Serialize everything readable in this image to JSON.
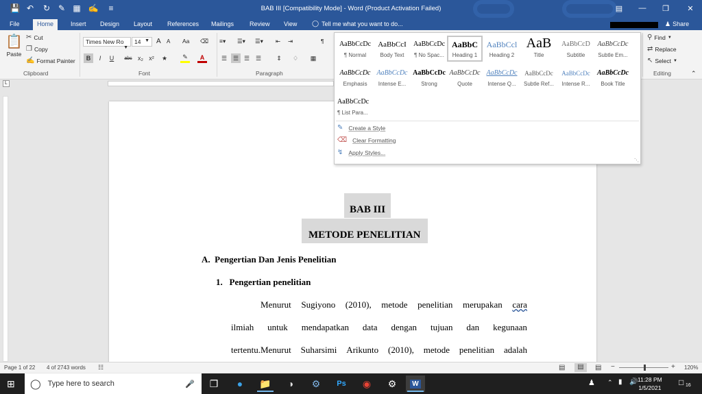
{
  "titlebar": {
    "title": "BAB III [Compatibility Mode] - Word (Product Activation Failed)",
    "share_label": "Share"
  },
  "tabs": [
    "File",
    "Home",
    "Insert",
    "Design",
    "Layout",
    "References",
    "Mailings",
    "Review",
    "View"
  ],
  "tell_me": "Tell me what you want to do...",
  "clipboard": {
    "paste": "Paste",
    "cut": "Cut",
    "copy": "Copy",
    "format_painter": "Format Painter",
    "label": "Clipboard"
  },
  "font": {
    "family": "Times New Ro",
    "size": "14",
    "label": "Font",
    "bold": "B",
    "italic": "I",
    "underline": "U",
    "strike": "abc",
    "sub": "x₂",
    "sup": "x²",
    "grow": "A",
    "shrink": "A",
    "case": "Aa",
    "color": "A"
  },
  "paragraph": {
    "label": "Paragraph"
  },
  "editing": {
    "find": "Find",
    "replace": "Replace",
    "select": "Select",
    "label": "Editing"
  },
  "styles": {
    "tiles": [
      {
        "sample": "AaBbCcDc",
        "name": "¶ Normal"
      },
      {
        "sample": "AaBbCcI",
        "name": "Body Text"
      },
      {
        "sample": "AaBbCcDc",
        "name": "¶ No Spac..."
      },
      {
        "sample": "AaBbC",
        "name": "Heading 1"
      },
      {
        "sample": "AaBbCcl",
        "name": "Heading 2"
      },
      {
        "sample": "AaB",
        "name": "Title"
      },
      {
        "sample": "AaBbCcD",
        "name": "Subtitle"
      },
      {
        "sample": "AaBbCcDc",
        "name": "Subtle Em..."
      },
      {
        "sample": "AaBbCcDc",
        "name": "Emphasis"
      },
      {
        "sample": "AaBbCcDc",
        "name": "Intense E..."
      },
      {
        "sample": "AaBbCcDc",
        "name": "Strong"
      },
      {
        "sample": "AaBbCcDc",
        "name": "Quote"
      },
      {
        "sample": "AaBbCcDc",
        "name": "Intense Q..."
      },
      {
        "sample": "AaBbCcDc",
        "name": "Subtle Ref..."
      },
      {
        "sample": "AaBbCcDc",
        "name": "Intense R..."
      },
      {
        "sample": "AaBbCcDc",
        "name": "Book Title"
      },
      {
        "sample": "AaBbCcDc",
        "name": "¶ List Para..."
      }
    ],
    "create_style": "Create a Style",
    "clear_formatting": "Clear Formatting",
    "apply_styles": "Apply Styles..."
  },
  "document": {
    "heading1": "BAB III",
    "heading2": "METODE PENELITIAN",
    "section_a": "A.  Pengertian Dan Jenis Penelitian",
    "subsection_1": "1.   Pengertian penelitian",
    "line1": [
      "Menurut",
      "Sugiyono",
      "(2010),",
      "metode",
      "penelitian",
      "merupakan",
      "cara"
    ],
    "line2": [
      "ilmiah",
      "untuk",
      "mendapatkan",
      "data",
      "dengan",
      "tujuan",
      "dan",
      "kegunaan"
    ],
    "line3": [
      "tertentu.Menurut",
      "Suharsimi",
      "Arikunto",
      "(2010),",
      "metode",
      "penelitian",
      "adalah"
    ]
  },
  "status": {
    "page": "Page 1 of 22",
    "words": "4 of 2743 words",
    "zoom": "120%"
  },
  "taskbar": {
    "search_placeholder": "Type here to search",
    "time": "11:28 PM",
    "date": "1/5/2021",
    "notifications": "16"
  },
  "colors": {
    "word_blue": "#2b579a",
    "ribbon_bg": "#f3f3f3",
    "taskbar_bg": "#1f1f1f"
  }
}
